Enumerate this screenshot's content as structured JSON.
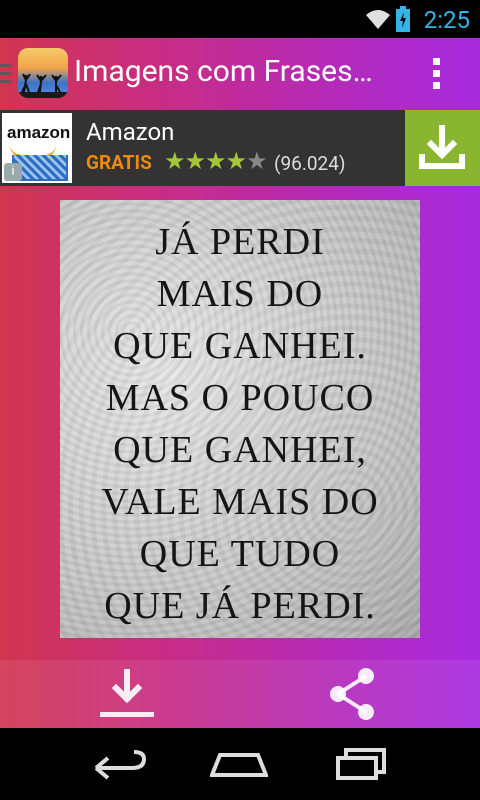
{
  "status_bar": {
    "time": "2:25"
  },
  "action_bar": {
    "title": "Imagens com Frases…"
  },
  "ad": {
    "logo_text": "amazon",
    "name": "Amazon",
    "price": "GRATIS",
    "stars_filled": "★★★★",
    "stars_empty": "★",
    "rating_count": "(96.024)"
  },
  "quote": {
    "lines": [
      "JÁ PERDI",
      "MAIS DO",
      "QUE GANHEI.",
      "MAS O POUCO",
      "QUE GANHEI,",
      "VALE MAIS DO",
      "QUE TUDO",
      "QUE JÁ PERDI."
    ]
  },
  "colors": {
    "gradient_start": "#d1354f",
    "gradient_end": "#a82ae0",
    "status_accent": "#33b5e5",
    "ad_button": "#8ab531"
  },
  "icons": {
    "download": "download-icon",
    "share": "share-icon",
    "back": "back-icon",
    "home": "home-icon",
    "recent": "recent-apps-icon"
  }
}
